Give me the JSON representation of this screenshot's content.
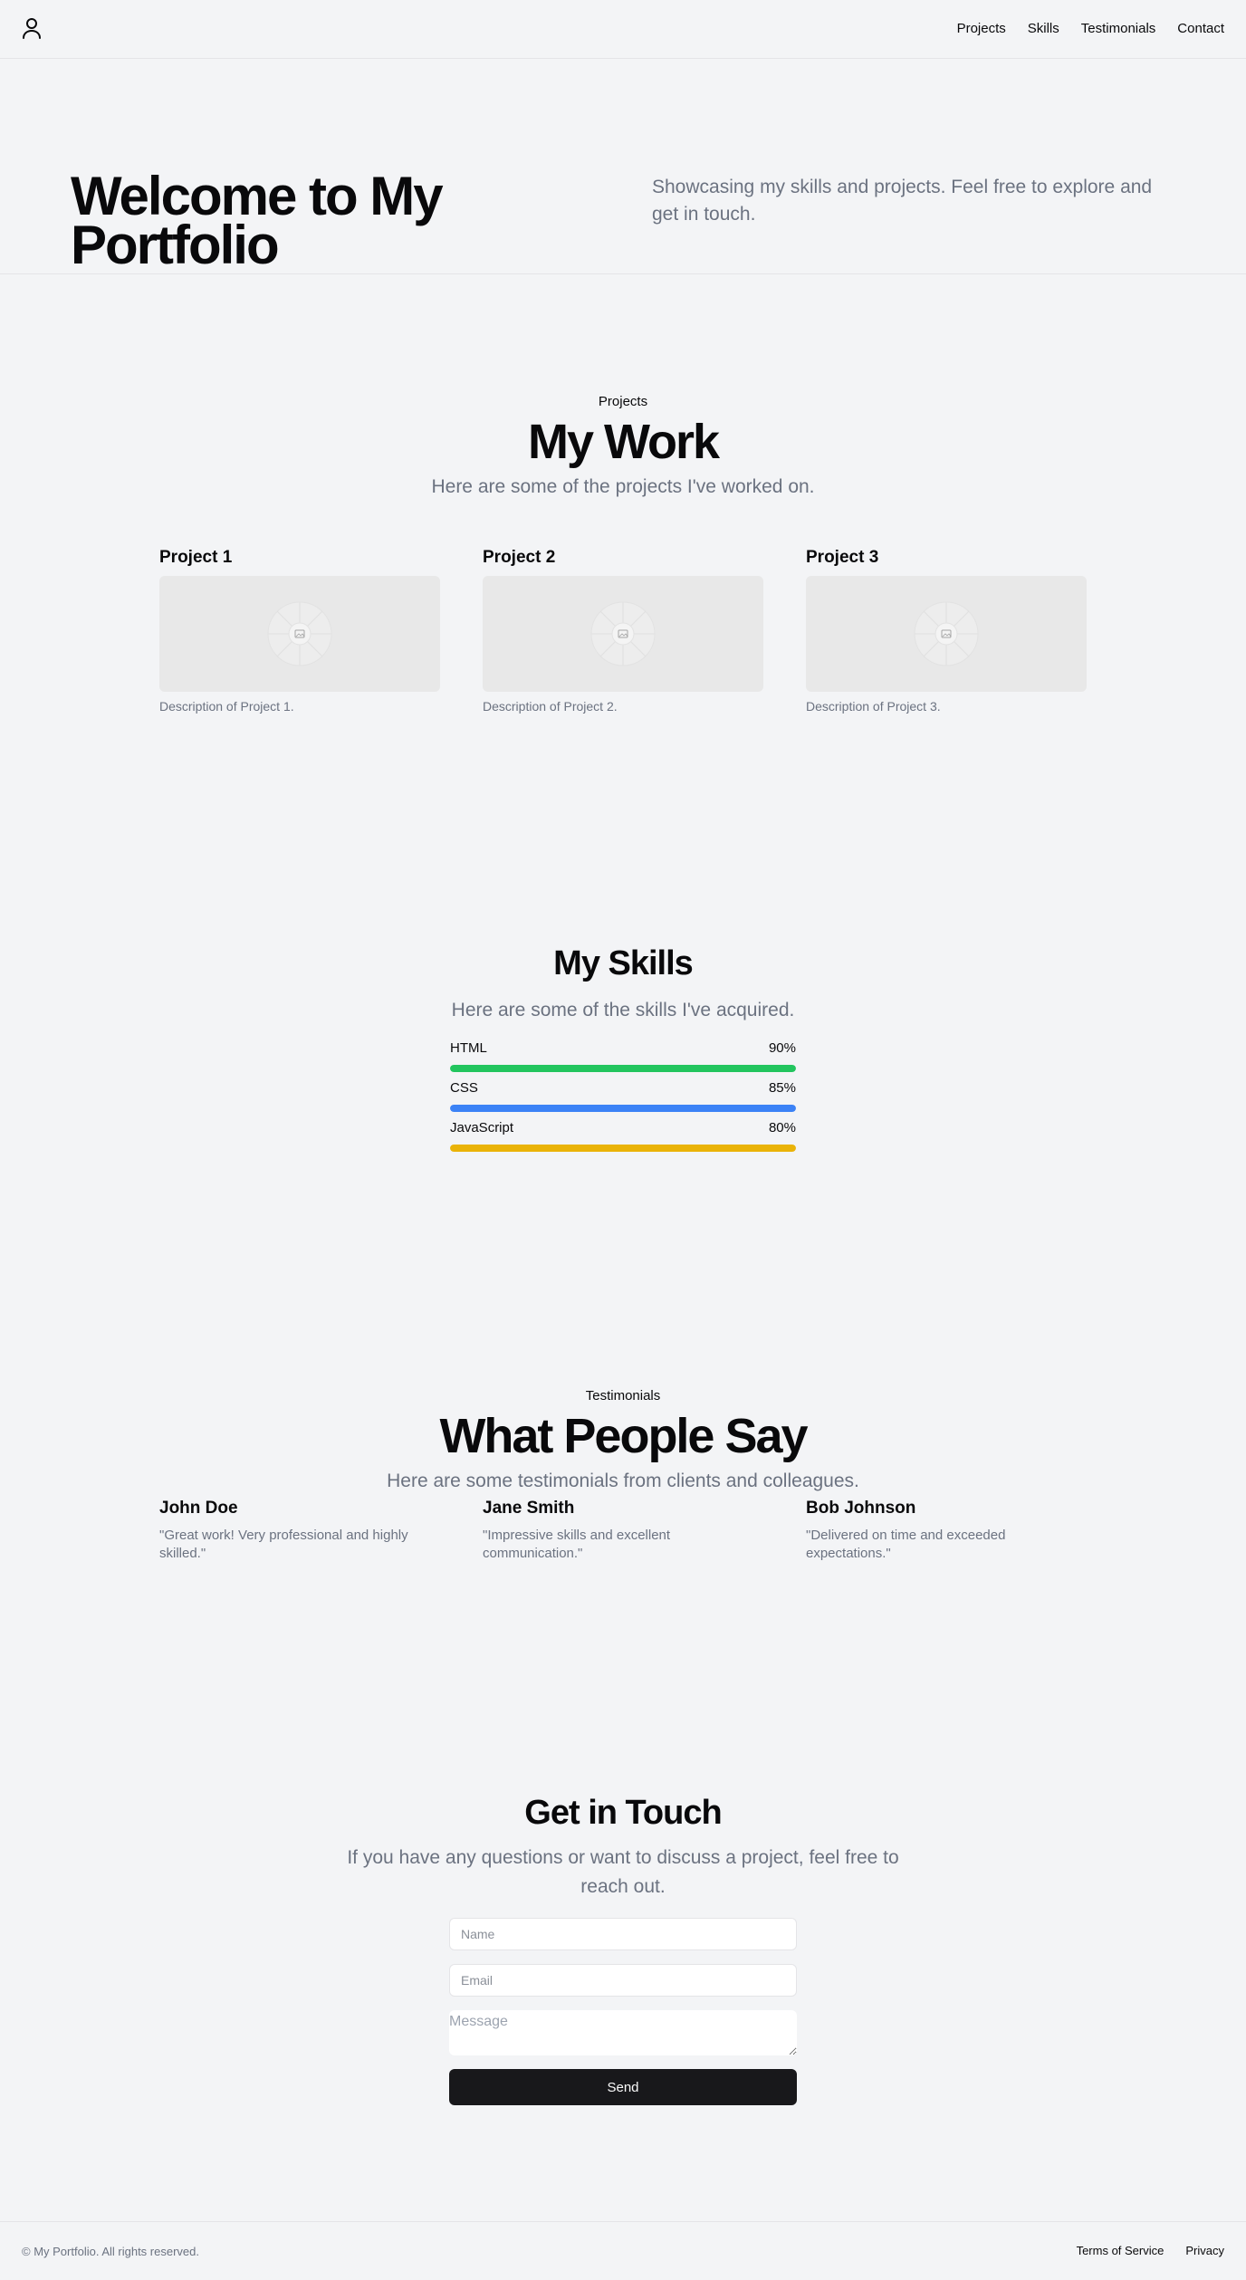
{
  "header": {
    "logo_icon": "user-icon",
    "nav": [
      {
        "label": "Projects"
      },
      {
        "label": "Skills"
      },
      {
        "label": "Testimonials"
      },
      {
        "label": "Contact"
      }
    ]
  },
  "hero": {
    "title": "Welcome to My Portfolio",
    "subtitle": "Showcasing my skills and projects. Feel free to explore and get in touch."
  },
  "projects": {
    "eyebrow": "Projects",
    "title": "My Work",
    "subtitle": "Here are some of the projects I've worked on.",
    "image_icon": "image-placeholder-icon",
    "items": [
      {
        "title": "Project 1",
        "description": "Description of Project 1."
      },
      {
        "title": "Project 2",
        "description": "Description of Project 2."
      },
      {
        "title": "Project 3",
        "description": "Description of Project 3."
      }
    ]
  },
  "skills": {
    "title": "My Skills",
    "subtitle": "Here are some of the skills I've acquired.",
    "items": [
      {
        "name": "HTML",
        "percent_label": "90%",
        "level": 90,
        "color": "#22c55e"
      },
      {
        "name": "CSS",
        "percent_label": "85%",
        "level": 85,
        "color": "#3b82f6"
      },
      {
        "name": "JavaScript",
        "percent_label": "80%",
        "level": 80,
        "color": "#eab308"
      }
    ]
  },
  "testimonials": {
    "eyebrow": "Testimonials",
    "title": "What People Say",
    "subtitle": "Here are some testimonials from clients and colleagues.",
    "items": [
      {
        "name": "John Doe",
        "quote": "\"Great work! Very professional and highly skilled.\""
      },
      {
        "name": "Jane Smith",
        "quote": "\"Impressive skills and excellent communication.\""
      },
      {
        "name": "Bob Johnson",
        "quote": "\"Delivered on time and exceeded expectations.\""
      }
    ]
  },
  "contact": {
    "title": "Get in Touch",
    "subtitle": "If you have any questions or want to discuss a project, feel free to reach out.",
    "name_placeholder": "Name",
    "email_placeholder": "Email",
    "message_placeholder": "Message",
    "send_label": "Send"
  },
  "footer": {
    "copyright": "© My Portfolio. All rights reserved.",
    "links": [
      {
        "label": "Terms of Service"
      },
      {
        "label": "Privacy"
      }
    ]
  }
}
